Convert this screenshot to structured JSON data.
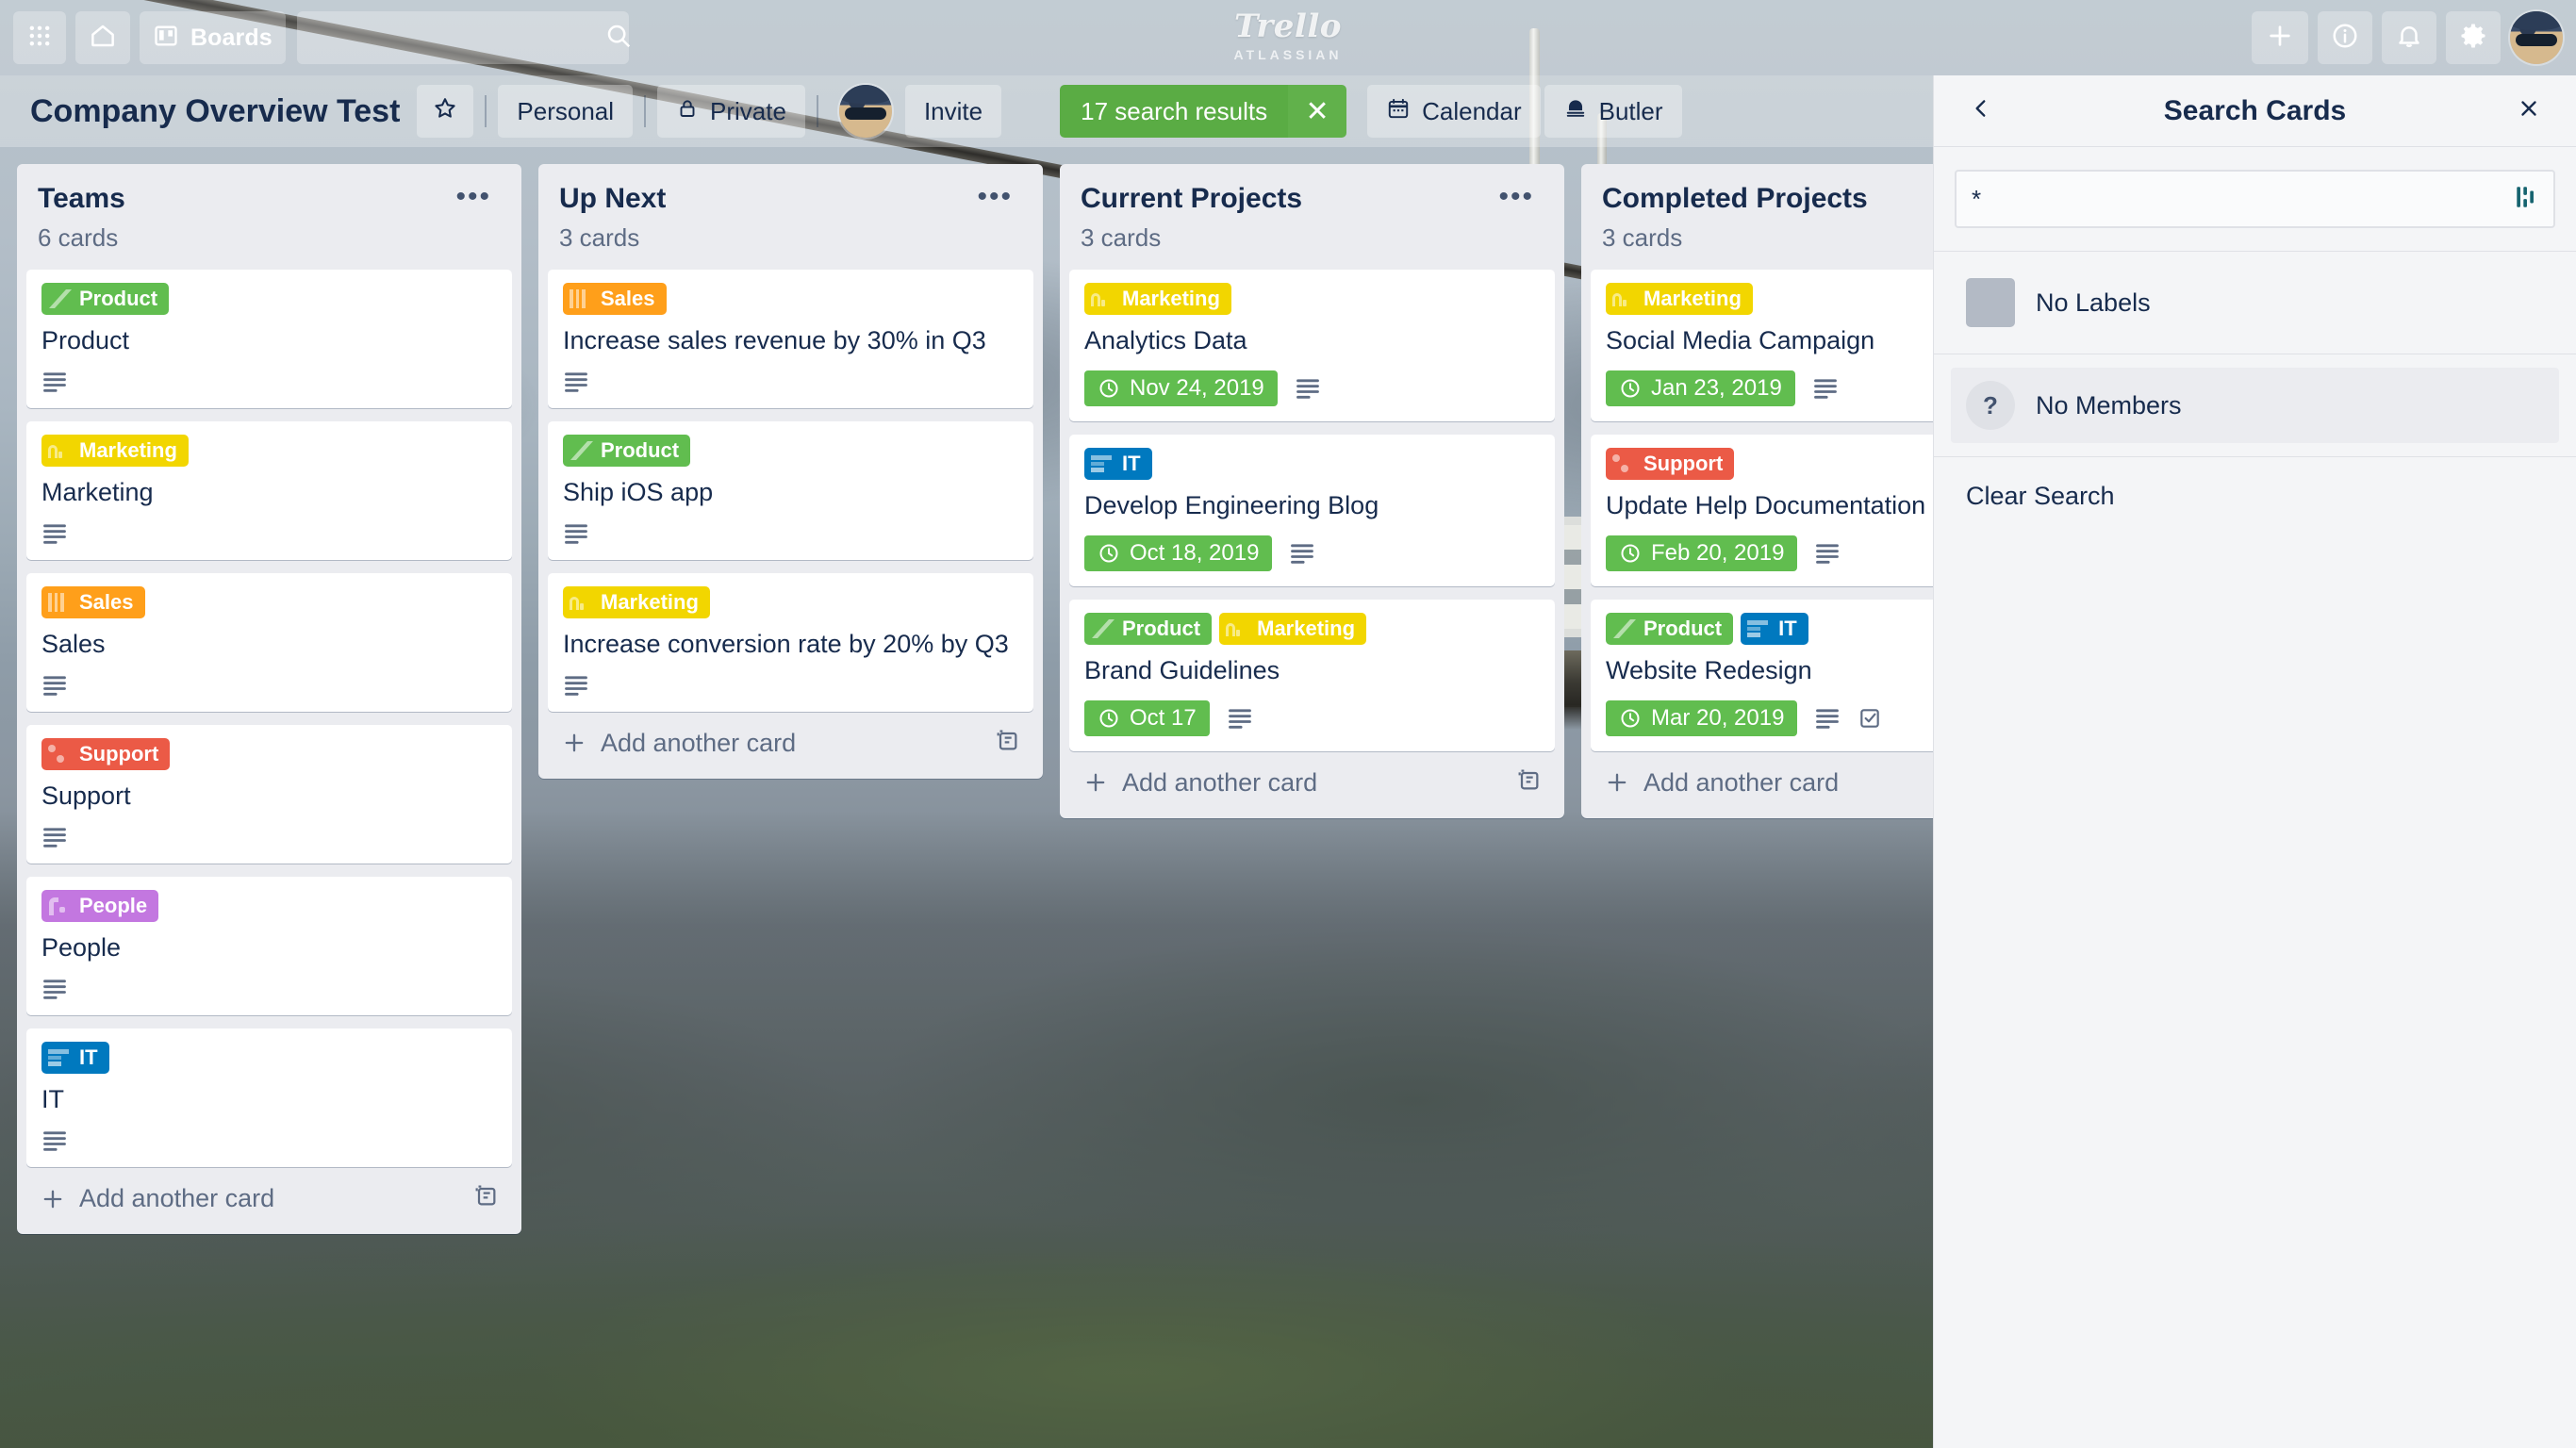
{
  "topbar": {
    "apps_icon": "grid-apps-icon",
    "home_icon": "home-icon",
    "boards_icon": "boards-icon",
    "boards_label": "Boards",
    "search_placeholder": "",
    "search_value": "",
    "search_icon": "search-icon",
    "brand_name": "Trello",
    "brand_sub": "ATLASSIAN",
    "add_icon": "plus-icon",
    "info_icon": "info-circle-icon",
    "notifications_icon": "bell-icon",
    "settings_icon": "gear-icon",
    "avatar": "user-avatar"
  },
  "boardbar": {
    "title": "Company Overview Test",
    "star_icon": "star-icon",
    "team_label": "Personal",
    "visibility_label": "Private",
    "visibility_icon": "lock-icon",
    "invite_label": "Invite",
    "member_avatar": "board-member-avatar",
    "search_results_label": "17 search results",
    "search_results_close": "✕",
    "calendar_label": "Calendar",
    "calendar_icon": "calendar-icon",
    "butler_label": "Butler",
    "butler_icon": "butler-bot-icon"
  },
  "colors": {
    "label_green": "#61bd4f",
    "label_yellow": "#f2d600",
    "label_orange": "#ff9f1a",
    "label_red": "#eb5a46",
    "label_purple": "#c377e0",
    "label_blue": "#0079bf",
    "due_green": "#61bd4f",
    "search_pill_green": "#5aac44",
    "text_dark": "#172b4d",
    "text_muted": "#5e6c84",
    "list_bg": "#ebecf0",
    "sidebar_bg": "#f4f5f7"
  },
  "add_card_label": "Add another card",
  "add_card_icon": "plus-icon",
  "card_template_icon": "card-template-icon",
  "lists": [
    {
      "title": "Teams",
      "count": "6 cards",
      "menu_icon": "list-menu-icon",
      "cards": [
        {
          "title": "Product",
          "labels": [
            {
              "name": "Product",
              "color": "#61bd4f",
              "pattern": "diagonal"
            }
          ],
          "description_icon": true
        },
        {
          "title": "Marketing",
          "labels": [
            {
              "name": "Marketing",
              "color": "#f2d600",
              "pattern": "wave"
            }
          ],
          "description_icon": true
        },
        {
          "title": "Sales",
          "labels": [
            {
              "name": "Sales",
              "color": "#ff9f1a",
              "pattern": "bars"
            }
          ],
          "description_icon": true
        },
        {
          "title": "Support",
          "labels": [
            {
              "name": "Support",
              "color": "#eb5a46",
              "pattern": "dots"
            }
          ],
          "description_icon": true
        },
        {
          "title": "People",
          "labels": [
            {
              "name": "People",
              "color": "#c377e0",
              "pattern": "zigzag"
            }
          ],
          "description_icon": true
        },
        {
          "title": "IT",
          "labels": [
            {
              "name": "IT",
              "color": "#0079bf",
              "pattern": "stripes"
            }
          ],
          "description_icon": true
        }
      ]
    },
    {
      "title": "Up Next",
      "count": "3 cards",
      "menu_icon": "list-menu-icon",
      "cards": [
        {
          "title": "Increase sales revenue by 30% in Q3",
          "labels": [
            {
              "name": "Sales",
              "color": "#ff9f1a",
              "pattern": "bars"
            }
          ],
          "description_icon": true
        },
        {
          "title": "Ship iOS app",
          "labels": [
            {
              "name": "Product",
              "color": "#61bd4f",
              "pattern": "diagonal"
            }
          ],
          "description_icon": true
        },
        {
          "title": "Increase conversion rate by 20% by Q3",
          "labels": [
            {
              "name": "Marketing",
              "color": "#f2d600",
              "pattern": "wave"
            }
          ],
          "description_icon": true
        }
      ]
    },
    {
      "title": "Current Projects",
      "count": "3 cards",
      "menu_icon": "list-menu-icon",
      "cards": [
        {
          "title": "Analytics Data",
          "labels": [
            {
              "name": "Marketing",
              "color": "#f2d600",
              "pattern": "wave"
            }
          ],
          "due": "Nov 24, 2019",
          "due_icon": "clock-icon",
          "description_icon": true
        },
        {
          "title": "Develop Engineering Blog",
          "labels": [
            {
              "name": "IT",
              "color": "#0079bf",
              "pattern": "stripes"
            }
          ],
          "due": "Oct 18, 2019",
          "due_icon": "clock-icon",
          "description_icon": true
        },
        {
          "title": "Brand Guidelines",
          "labels": [
            {
              "name": "Product",
              "color": "#61bd4f",
              "pattern": "diagonal"
            },
            {
              "name": "Marketing",
              "color": "#f2d600",
              "pattern": "wave"
            }
          ],
          "due": "Oct 17",
          "due_icon": "clock-icon",
          "description_icon": true
        }
      ]
    },
    {
      "title": "Completed Projects",
      "count": "3 cards",
      "menu_icon": "list-menu-icon",
      "cards": [
        {
          "title": "Social Media Campaign",
          "labels": [
            {
              "name": "Marketing",
              "color": "#f2d600",
              "pattern": "wave"
            }
          ],
          "due": "Jan 23, 2019",
          "due_icon": "clock-icon",
          "description_icon": true
        },
        {
          "title": "Update Help Documentation",
          "labels": [
            {
              "name": "Support",
              "color": "#eb5a46",
              "pattern": "dots"
            }
          ],
          "due": "Feb 20, 2019",
          "due_icon": "clock-icon",
          "description_icon": true
        },
        {
          "title": "Website Redesign",
          "labels": [
            {
              "name": "Product",
              "color": "#61bd4f",
              "pattern": "diagonal"
            },
            {
              "name": "IT",
              "color": "#0079bf",
              "pattern": "stripes"
            }
          ],
          "due": "Mar 20, 2019",
          "due_icon": "clock-icon",
          "description_icon": true,
          "checklist_icon": true
        }
      ]
    }
  ],
  "sidebar": {
    "back_icon": "chevron-left-icon",
    "title": "Search Cards",
    "close_icon": "close-icon",
    "search_value": "*",
    "search_placeholder": "",
    "search_field_icon": "sort-filter-icon",
    "labels_row": {
      "label": "No Labels",
      "swatch": "no-label-swatch"
    },
    "members_row": {
      "label": "No Members",
      "avatar_glyph": "?"
    },
    "clear_label": "Clear Search"
  }
}
